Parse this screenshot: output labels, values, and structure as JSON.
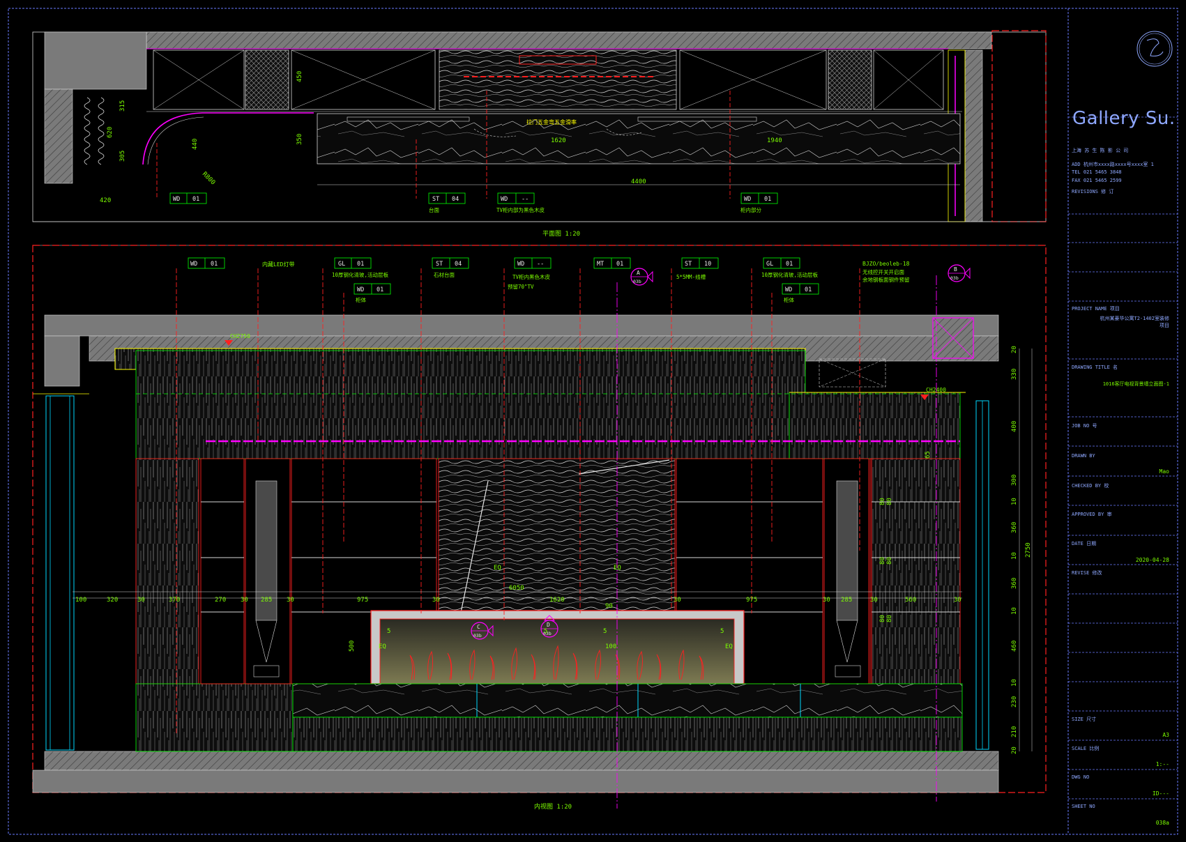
{
  "title_block": {
    "brand": "Gallery Su.",
    "company_line": "上海   苏  生    陈  影  公  司",
    "address_line": "ADD  杭州市xxxx路xxxx号xxxx室  1",
    "tel_line": "TEL  021 5465 3848",
    "fax_line": "FAX  021 5465 2599",
    "revisions_label": "REVISIONS  修 订",
    "project_name_label": "PROJECT NAME  项目",
    "project_name_value_1": "杭州某豪华公寓T2-1402室装修",
    "project_name_value_2": "项目",
    "drawing_title_label": "DRAWING TITLE  名",
    "drawing_title_value": "1016客厅电视背景墙立面图-1",
    "job_no_label": "JOB NO  号",
    "drawn_by_label": "DRAWN BY",
    "drawn_by_value": "Mao",
    "checked_by_label": "CHECKED BY  校",
    "approved_by_label": "APPROVED BY  审",
    "date_label": "DATE  日期",
    "date_value": "2020-04-28",
    "revise_label": "REVISE  修改",
    "size_label": "SIZE  尺寸",
    "size_value": "A3",
    "scale_label": "SCALE  比例",
    "scale_value": "1:--",
    "dwg_no_label": "DWG NO",
    "dwg_no_value": "ID---",
    "sheet_no_label": "SHEET NO",
    "sheet_no_value": "038a"
  },
  "plan": {
    "caption": "平面图 1:20",
    "note_top": "拉门五金弯五金滑率",
    "dims": [
      "450",
      "315",
      "620",
      "305",
      "440",
      "420",
      "350",
      "1620",
      "1940",
      "4400",
      "R800"
    ],
    "tags": [
      {
        "code": "WD",
        "num": "01",
        "note": ""
      },
      {
        "code": "ST",
        "num": "04",
        "note": "台面"
      },
      {
        "code": "WD",
        "num": "--",
        "note": "TV柜内部为黑色木皮"
      },
      {
        "code": "WD",
        "num": "01",
        "note": "柜内部分"
      }
    ]
  },
  "elevation": {
    "caption": "内视图 1:20",
    "ch_top": "CH2750",
    "ch_right": "CH2400",
    "header_note": "内藏LED灯带",
    "tags": [
      {
        "code": "WD",
        "num": "01",
        "note": ""
      },
      {
        "code": "GL",
        "num": "01",
        "note": "10厚钢化清玻,活动层板"
      },
      {
        "code": "WD",
        "num": "01",
        "note": "柜体"
      },
      {
        "code": "ST",
        "num": "04",
        "note": "石材台面"
      },
      {
        "code": "WD",
        "num": "--",
        "note": "TV柜内黑色木皮"
      },
      {
        "code": "MT",
        "num": "01",
        "note": ""
      },
      {
        "code": "ST",
        "num": "10",
        "note": "5*5MM-线槽"
      },
      {
        "code": "GL",
        "num": "01",
        "note": "10厚钢化清玻,活动层板"
      },
      {
        "code": "WD",
        "num": "01",
        "note": "柜体"
      }
    ],
    "tv_note_2": "预留70\"TV",
    "right_note_1": "BJZO/beoleb-18",
    "right_note_2": "无线控开关开启面",
    "right_note_3": "余地钢板面钢件预留",
    "section_A": {
      "letter": "A",
      "sheet": "03b"
    },
    "section_B": {
      "letter": "B",
      "sheet": "03b"
    },
    "section_C": {
      "letter": "C",
      "sheet": "03b"
    },
    "section_D": {
      "letter": "D",
      "sheet": "03b"
    },
    "horiz_dims": [
      "100",
      "320",
      "30",
      "370",
      "270",
      "30",
      "285",
      "30",
      "975",
      "30",
      "1620",
      "30",
      "975",
      "30",
      "285",
      "30",
      "560",
      "30"
    ],
    "overall_width": "6050",
    "vert_dims": [
      "20",
      "330",
      "400",
      "65",
      "300",
      "10",
      "360",
      "10",
      "360",
      "10",
      "460",
      "10",
      "230",
      "210",
      "20"
    ],
    "overall_height": "2750",
    "small_dims": [
      "80",
      "80",
      "80",
      "80",
      "80",
      "80"
    ],
    "eq": "EQ",
    "fire_dims": [
      "500",
      "5",
      "5",
      "5",
      "5",
      "100"
    ],
    "mid_dim": "90"
  },
  "colors": {
    "red": "#ff2020",
    "green": "#00ff00",
    "magenta": "#ff00ff",
    "cyan": "#00d8ff",
    "yellow": "#ffff00",
    "white": "#e8e8e8",
    "grey": "#808080",
    "blue": "#6a7cff"
  }
}
